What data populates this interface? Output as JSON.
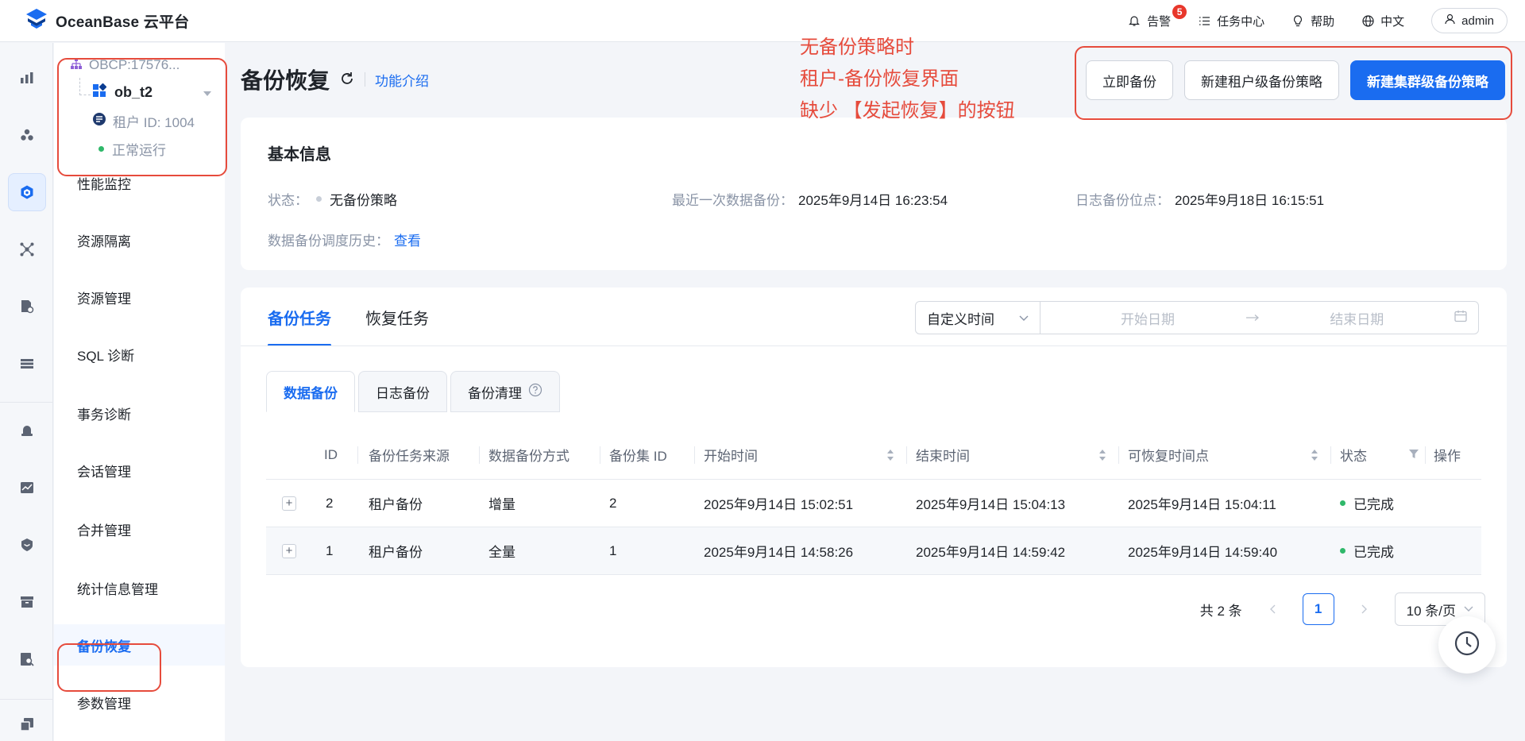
{
  "app": {
    "logo_text": "OceanBase 云平台"
  },
  "topbar": {
    "alerts_label": "告警",
    "alerts_count": "5",
    "task_center_label": "任务中心",
    "help_label": "帮助",
    "language_label": "中文",
    "user_label": "admin"
  },
  "tenant": {
    "cluster_path": "OBCP:17576...",
    "name": "ob_t2",
    "id_text": "租户 ID: 1004",
    "status": "正常运行"
  },
  "subnav": {
    "items": [
      {
        "label": "性能监控"
      },
      {
        "label": "资源隔离"
      },
      {
        "label": "资源管理"
      },
      {
        "label": "SQL 诊断"
      },
      {
        "label": "事务诊断"
      },
      {
        "label": "会话管理"
      },
      {
        "label": "合并管理"
      },
      {
        "label": "统计信息管理"
      },
      {
        "label": "备份恢复"
      },
      {
        "label": "参数管理"
      }
    ],
    "active_index": 8
  },
  "annotation": {
    "lines": [
      "无备份策略时",
      "租户-备份恢复界面",
      "缺少 【发起恢复】的按钮"
    ]
  },
  "page": {
    "title": "备份恢复",
    "intro_link": "功能介绍",
    "actions": {
      "backup_now": "立即备份",
      "new_tenant_policy": "新建租户级备份策略",
      "new_cluster_policy": "新建集群级备份策略"
    }
  },
  "basic_info": {
    "title": "基本信息",
    "status_label": "状态：",
    "status_value": "无备份策略",
    "last_backup_label": "最近一次数据备份：",
    "last_backup_value": "2025年9月14日 16:23:54",
    "log_point_label": "日志备份位点：",
    "log_point_value": "2025年9月18日 16:15:51",
    "history_label": "数据备份调度历史：",
    "history_link": "查看"
  },
  "tasks": {
    "tabs": [
      "备份任务",
      "恢复任务"
    ],
    "filter": {
      "select_value": "自定义时间",
      "start_placeholder": "开始日期",
      "end_placeholder": "结束日期"
    },
    "subtabs": [
      "数据备份",
      "日志备份",
      "备份清理"
    ],
    "columns": [
      "ID",
      "备份任务来源",
      "数据备份方式",
      "备份集 ID",
      "开始时间",
      "结束时间",
      "可恢复时间点",
      "状态",
      "操作"
    ],
    "rows": [
      {
        "id": "2",
        "source": "租户备份",
        "mode": "增量",
        "set_id": "2",
        "start": "2025年9月14日 15:02:51",
        "end": "2025年9月14日 15:04:13",
        "restorable": "2025年9月14日 15:04:11",
        "status": "已完成"
      },
      {
        "id": "1",
        "source": "租户备份",
        "mode": "全量",
        "set_id": "1",
        "start": "2025年9月14日 14:58:26",
        "end": "2025年9月14日 14:59:42",
        "restorable": "2025年9月14日 14:59:40",
        "status": "已完成"
      }
    ],
    "pagination": {
      "total": "共 2 条",
      "current": "1",
      "page_size": "10 条/页"
    }
  },
  "colors": {
    "primary": "#1a6cf0",
    "annotation": "#e64b3c",
    "success": "#2fb86a"
  }
}
